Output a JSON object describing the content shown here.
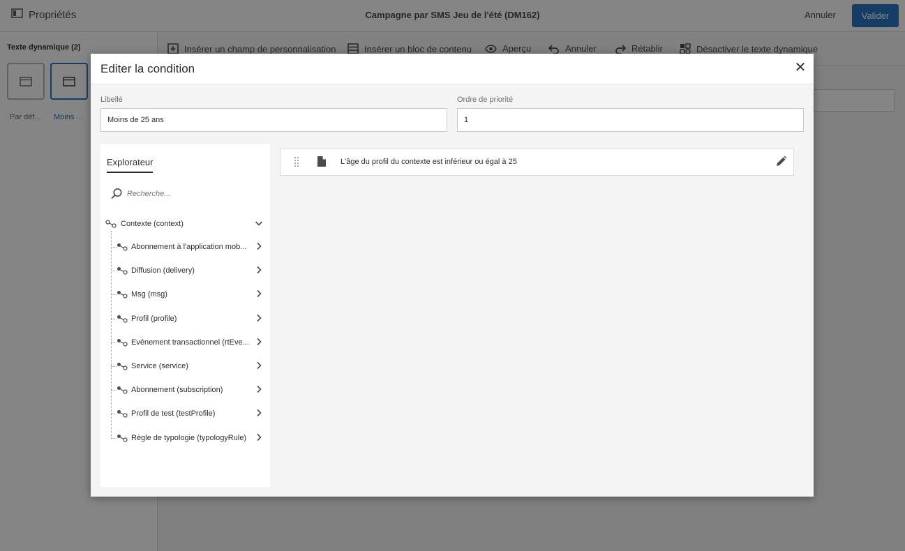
{
  "app": {
    "properties_label": "Propriétés",
    "title": "Campagne par SMS Jeu de l'été (DM162)",
    "cancel_label": "Annuler",
    "validate_label": "Valider"
  },
  "left_panel": {
    "heading": "Texte dynamique (2)",
    "tiles": [
      {
        "label": "Par déf..."
      },
      {
        "label": "Moins ..."
      }
    ]
  },
  "toolbar": {
    "items": [
      {
        "label": "Insérer un champ de personnalisation",
        "icon": "insert-field-icon"
      },
      {
        "label": "Insérer un bloc de contenu",
        "icon": "content-block-icon"
      },
      {
        "label": "Aperçu",
        "icon": "eye-icon"
      },
      {
        "label": "Annuler",
        "icon": "undo-icon"
      },
      {
        "label": "Rétablir",
        "icon": "redo-icon"
      },
      {
        "label": "Désactiver le texte dynamique",
        "icon": "disable-dynamic-text-icon"
      }
    ]
  },
  "modal": {
    "title": "Editer la condition",
    "close_icon": "close-icon",
    "label_field": {
      "label": "Libellé",
      "value": "Moins de 25 ans"
    },
    "priority_field": {
      "label": "Ordre de priorité",
      "value": "1"
    },
    "explorer": {
      "tab_label": "Explorateur",
      "search_placeholder": "Recherche...",
      "root": "Contexte (context)",
      "items": [
        "Abonnement à l'application mob...",
        "Diffusion (delivery)",
        "Msg (msg)",
        "Profil (profile)",
        "Evénement transactionnel (rtEve...",
        "Service (service)",
        "Abonnement (subscription)",
        "Profil de test (testProfile)",
        "Règle de typologie (typologyRule)"
      ]
    },
    "condition": {
      "text": "L'âge du profil du contexte est inférieur ou égal à 25"
    }
  },
  "colors": {
    "accent": "#2d73c2",
    "overlay": "rgba(0,0,0,0.48)"
  }
}
